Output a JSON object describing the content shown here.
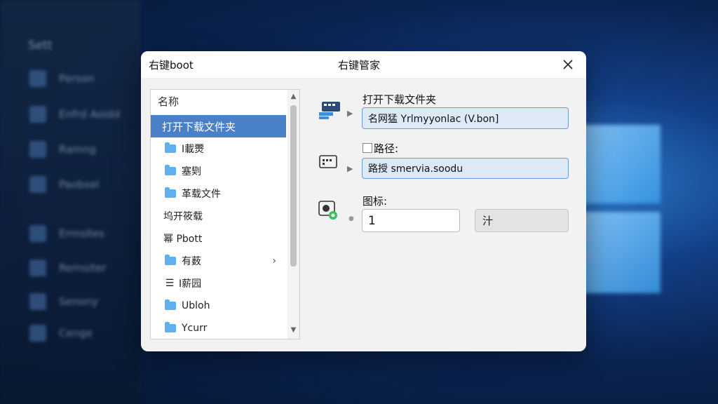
{
  "background": {
    "title": "Sett",
    "items": [
      "Person",
      "Enfrd Aoidd",
      "Ramng",
      "Paobsel",
      "Ermsites",
      "Rernsiter",
      "Senony",
      "Cenge"
    ]
  },
  "window": {
    "app_title": "右键boot",
    "dialog_title": "右键管家",
    "close_icon": "close-icon"
  },
  "tree": {
    "header": "名称",
    "items": [
      {
        "label": "打开下载文件夹",
        "icon": "none",
        "selected": true
      },
      {
        "label": "I載燛",
        "icon": "folder-icon"
      },
      {
        "label": "塞㓶",
        "icon": "folder-icon"
      },
      {
        "label": "革载文件",
        "icon": "folder-icon"
      },
      {
        "label": "坞开筱载",
        "icon": "none"
      },
      {
        "label": "幂 Pbott",
        "icon": "none"
      },
      {
        "label": "有薮",
        "icon": "folder-icon",
        "expandable": true
      },
      {
        "label": "I薪园",
        "icon": "menu-icon"
      },
      {
        "label": "Ubloh",
        "icon": "folder-icon"
      },
      {
        "label": "Ycurr",
        "icon": "folder-icon"
      }
    ]
  },
  "form": {
    "name_label": "打开下载文件夹",
    "name_value": "名网猛 Yrlmyyonlac (V.bon]",
    "path_label": "路径:",
    "path_value": "路授 smervia.soodu",
    "icon_label": "图标:",
    "icon_value": "1",
    "browse_label": "汁"
  },
  "colors": {
    "selection": "#4a80c8",
    "field_border": "#6e9bd4",
    "field_bg": "#dde9f7"
  }
}
